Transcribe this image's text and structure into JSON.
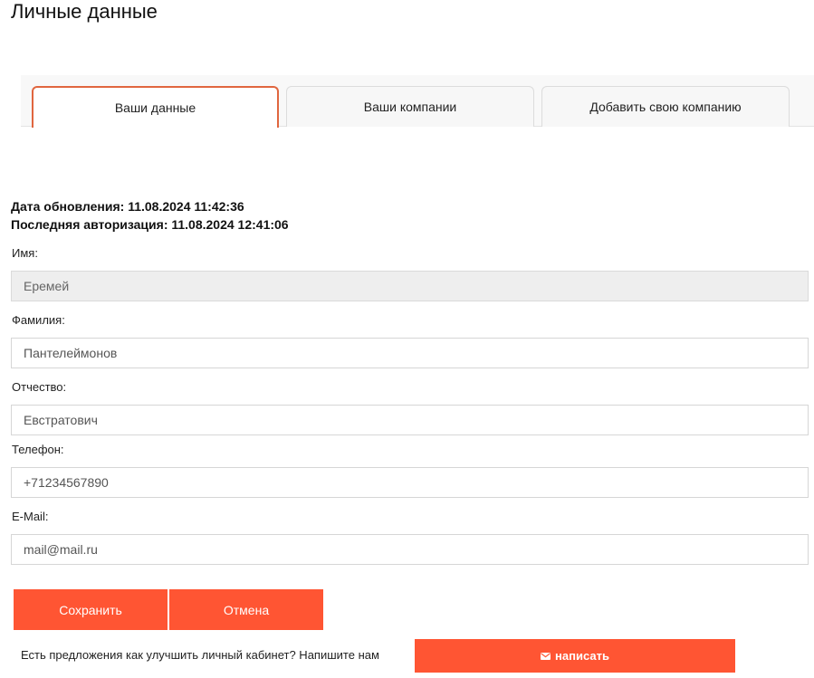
{
  "page": {
    "title": "Личные данные"
  },
  "tabs": [
    {
      "label": "Ваши данные",
      "active": true
    },
    {
      "label": "Ваши компании",
      "active": false
    },
    {
      "label": "Добавить свою компанию",
      "active": false
    }
  ],
  "meta": {
    "updated": "Дата обновления: 11.08.2024 11:42:36",
    "last_login": "Последняя авторизация: 11.08.2024 12:41:06"
  },
  "form": {
    "first_name": {
      "label": "Имя:",
      "value": "Еремей"
    },
    "last_name": {
      "label": "Фамилия:",
      "value": "Пантелеймонов"
    },
    "middle_name": {
      "label": "Отчество:",
      "value": "Евстратович"
    },
    "phone": {
      "label": "Телефон:",
      "value": "+71234567890"
    },
    "email": {
      "label": "E-Mail:",
      "value": "mail@mail.ru"
    }
  },
  "actions": {
    "save": "Сохранить",
    "cancel": "Отмена"
  },
  "feedback": {
    "text": "Есть предложения как улучшить личный кабинет? Напишите нам",
    "button": "написать",
    "icon": "envelope-icon"
  },
  "colors": {
    "accent": "#ff5533",
    "active_tab_border": "#e0663f"
  }
}
